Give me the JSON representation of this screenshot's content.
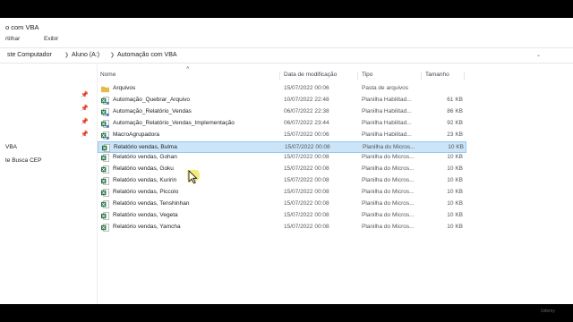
{
  "window": {
    "title": "o com VBA"
  },
  "ribbon": {
    "share_label": "rtilhar",
    "view_label": "Exibir"
  },
  "address": {
    "crumbs": [
      "ste Computador",
      "Aluno (A:)",
      "Automação com VBA"
    ]
  },
  "nav": {
    "items": [
      "VBA",
      "te Busca CEP"
    ]
  },
  "columns": {
    "name": "Nome",
    "date": "Data de modificação",
    "type": "Tipo",
    "size": "Tamanho"
  },
  "files": [
    {
      "name": "Arquivos",
      "date": "15/07/2022 00:06",
      "type": "Pasta de arquivos",
      "size": "",
      "icon": "folder-icon"
    },
    {
      "name": "Automação_Quebrar_Arquivo",
      "date": "10/07/2022 22:48",
      "type": "Planilha Habilitad...",
      "size": "61 KB",
      "icon": "excel-macro-icon"
    },
    {
      "name": "Automação_Relatório_Vendas",
      "date": "06/07/2022 22:38",
      "type": "Planilha Habilitad...",
      "size": "86 KB",
      "icon": "excel-macro-icon"
    },
    {
      "name": "Automação_Relatório_Vendas_Implementação",
      "date": "06/07/2022 23:44",
      "type": "Planilha Habilitad...",
      "size": "92 KB",
      "icon": "excel-macro-icon"
    },
    {
      "name": "MacroAgrupadora",
      "date": "15/07/2022 00:06",
      "type": "Planilha Habilitad...",
      "size": "23 KB",
      "icon": "excel-macro-icon"
    },
    {
      "name": "Relatório vendas, Bulma",
      "date": "15/07/2022 00:08",
      "type": "Planilha do Micros...",
      "size": "10 KB",
      "icon": "excel-icon",
      "selected": true
    },
    {
      "name": "Relatório vendas, Gohan",
      "date": "15/07/2022 00:08",
      "type": "Planilha do Micros...",
      "size": "10 KB",
      "icon": "excel-icon"
    },
    {
      "name": "Relatório vendas, Goku",
      "date": "15/07/2022 00:08",
      "type": "Planilha do Micros...",
      "size": "10 KB",
      "icon": "excel-icon"
    },
    {
      "name": "Relatório vendas, Kuririn",
      "date": "15/07/2022 00:08",
      "type": "Planilha do Micros...",
      "size": "10 KB",
      "icon": "excel-icon"
    },
    {
      "name": "Relatório vendas, Piccolo",
      "date": "15/07/2022 00:08",
      "type": "Planilha do Micros...",
      "size": "10 KB",
      "icon": "excel-icon"
    },
    {
      "name": "Relatório vendas, Tenshinhan",
      "date": "15/07/2022 00:08",
      "type": "Planilha do Micros...",
      "size": "10 KB",
      "icon": "excel-icon"
    },
    {
      "name": "Relatório vendas, Vegeta",
      "date": "15/07/2022 00:08",
      "type": "Planilha do Micros...",
      "size": "10 KB",
      "icon": "excel-icon"
    },
    {
      "name": "Relatório vendas, Yamcha",
      "date": "15/07/2022 00:08",
      "type": "Planilha do Micros...",
      "size": "10 KB",
      "icon": "excel-icon"
    }
  ],
  "watermark": "Udemy",
  "colors": {
    "selection": "#cce4f7",
    "excel": "#1d6f42",
    "folder": "#e8b84a",
    "cursor_halo": "#f2e64a"
  }
}
